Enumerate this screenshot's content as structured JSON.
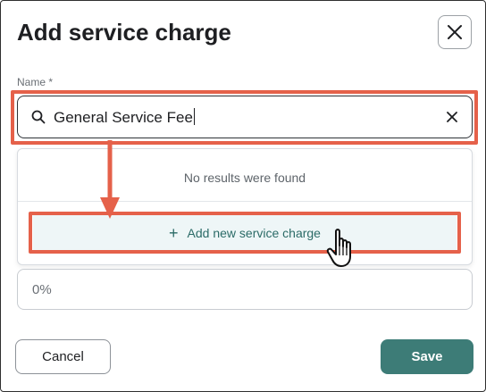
{
  "dialog": {
    "title": "Add service charge",
    "close_icon": "close-icon"
  },
  "name_field": {
    "label": "Name *",
    "value": "General Service Fee",
    "search_icon": "search-icon",
    "clear_icon": "clear-icon"
  },
  "dropdown": {
    "no_results_text": "No results were found",
    "add_new_label": "Add new service charge",
    "add_new_icon": "plus-icon"
  },
  "rate_field": {
    "value": "0%"
  },
  "footer": {
    "cancel_label": "Cancel",
    "save_label": "Save"
  },
  "colors": {
    "annotation_red": "#e5614a",
    "primary_teal": "#3d7c77",
    "add_new_bg": "#eef6f7",
    "add_new_text": "#2b6b67"
  }
}
